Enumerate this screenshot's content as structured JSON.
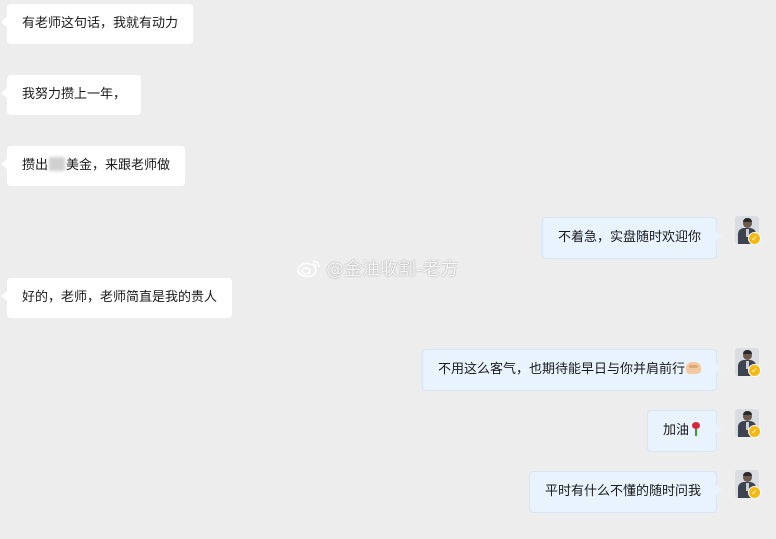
{
  "messages": [
    {
      "side": "left",
      "text": "有老师这句话，我就有动力"
    },
    {
      "side": "left",
      "text": "我努力攒上一年，"
    },
    {
      "side": "left",
      "text_before": "攒出",
      "text_after": "美金，来跟老师做"
    },
    {
      "side": "right",
      "text": "不着急，实盘随时欢迎你"
    },
    {
      "side": "left",
      "text": "好的，老师，老师简直是我的贵人"
    },
    {
      "side": "right",
      "text": "不用这么客气，也期待能早日与你并肩前行",
      "emoji": "handshake-emoji"
    },
    {
      "side": "right",
      "text": "加油",
      "emoji": "rose-emoji"
    },
    {
      "side": "right",
      "text": "平时有什么不懂的随时问我"
    }
  ],
  "watermark": {
    "text": "@金油收割-老方",
    "icon": "weibo-icon"
  },
  "colors": {
    "background": "#ededed",
    "left_bubble": "#ffffff",
    "right_bubble": "#e8f3fd",
    "verified_badge": "#f5b80f"
  }
}
